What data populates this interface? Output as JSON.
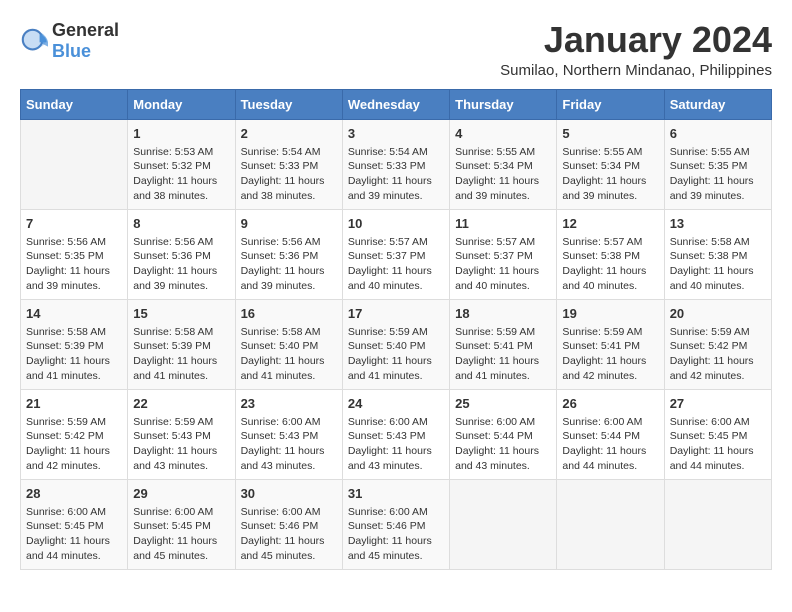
{
  "header": {
    "logo_general": "General",
    "logo_blue": "Blue",
    "title": "January 2024",
    "subtitle": "Sumilao, Northern Mindanao, Philippines"
  },
  "days_of_week": [
    "Sunday",
    "Monday",
    "Tuesday",
    "Wednesday",
    "Thursday",
    "Friday",
    "Saturday"
  ],
  "weeks": [
    [
      {
        "day": "",
        "info": ""
      },
      {
        "day": "1",
        "info": "Sunrise: 5:53 AM\nSunset: 5:32 PM\nDaylight: 11 hours\nand 38 minutes."
      },
      {
        "day": "2",
        "info": "Sunrise: 5:54 AM\nSunset: 5:33 PM\nDaylight: 11 hours\nand 38 minutes."
      },
      {
        "day": "3",
        "info": "Sunrise: 5:54 AM\nSunset: 5:33 PM\nDaylight: 11 hours\nand 39 minutes."
      },
      {
        "day": "4",
        "info": "Sunrise: 5:55 AM\nSunset: 5:34 PM\nDaylight: 11 hours\nand 39 minutes."
      },
      {
        "day": "5",
        "info": "Sunrise: 5:55 AM\nSunset: 5:34 PM\nDaylight: 11 hours\nand 39 minutes."
      },
      {
        "day": "6",
        "info": "Sunrise: 5:55 AM\nSunset: 5:35 PM\nDaylight: 11 hours\nand 39 minutes."
      }
    ],
    [
      {
        "day": "7",
        "info": "Sunrise: 5:56 AM\nSunset: 5:35 PM\nDaylight: 11 hours\nand 39 minutes."
      },
      {
        "day": "8",
        "info": "Sunrise: 5:56 AM\nSunset: 5:36 PM\nDaylight: 11 hours\nand 39 minutes."
      },
      {
        "day": "9",
        "info": "Sunrise: 5:56 AM\nSunset: 5:36 PM\nDaylight: 11 hours\nand 39 minutes."
      },
      {
        "day": "10",
        "info": "Sunrise: 5:57 AM\nSunset: 5:37 PM\nDaylight: 11 hours\nand 40 minutes."
      },
      {
        "day": "11",
        "info": "Sunrise: 5:57 AM\nSunset: 5:37 PM\nDaylight: 11 hours\nand 40 minutes."
      },
      {
        "day": "12",
        "info": "Sunrise: 5:57 AM\nSunset: 5:38 PM\nDaylight: 11 hours\nand 40 minutes."
      },
      {
        "day": "13",
        "info": "Sunrise: 5:58 AM\nSunset: 5:38 PM\nDaylight: 11 hours\nand 40 minutes."
      }
    ],
    [
      {
        "day": "14",
        "info": "Sunrise: 5:58 AM\nSunset: 5:39 PM\nDaylight: 11 hours\nand 41 minutes."
      },
      {
        "day": "15",
        "info": "Sunrise: 5:58 AM\nSunset: 5:39 PM\nDaylight: 11 hours\nand 41 minutes."
      },
      {
        "day": "16",
        "info": "Sunrise: 5:58 AM\nSunset: 5:40 PM\nDaylight: 11 hours\nand 41 minutes."
      },
      {
        "day": "17",
        "info": "Sunrise: 5:59 AM\nSunset: 5:40 PM\nDaylight: 11 hours\nand 41 minutes."
      },
      {
        "day": "18",
        "info": "Sunrise: 5:59 AM\nSunset: 5:41 PM\nDaylight: 11 hours\nand 41 minutes."
      },
      {
        "day": "19",
        "info": "Sunrise: 5:59 AM\nSunset: 5:41 PM\nDaylight: 11 hours\nand 42 minutes."
      },
      {
        "day": "20",
        "info": "Sunrise: 5:59 AM\nSunset: 5:42 PM\nDaylight: 11 hours\nand 42 minutes."
      }
    ],
    [
      {
        "day": "21",
        "info": "Sunrise: 5:59 AM\nSunset: 5:42 PM\nDaylight: 11 hours\nand 42 minutes."
      },
      {
        "day": "22",
        "info": "Sunrise: 5:59 AM\nSunset: 5:43 PM\nDaylight: 11 hours\nand 43 minutes."
      },
      {
        "day": "23",
        "info": "Sunrise: 6:00 AM\nSunset: 5:43 PM\nDaylight: 11 hours\nand 43 minutes."
      },
      {
        "day": "24",
        "info": "Sunrise: 6:00 AM\nSunset: 5:43 PM\nDaylight: 11 hours\nand 43 minutes."
      },
      {
        "day": "25",
        "info": "Sunrise: 6:00 AM\nSunset: 5:44 PM\nDaylight: 11 hours\nand 43 minutes."
      },
      {
        "day": "26",
        "info": "Sunrise: 6:00 AM\nSunset: 5:44 PM\nDaylight: 11 hours\nand 44 minutes."
      },
      {
        "day": "27",
        "info": "Sunrise: 6:00 AM\nSunset: 5:45 PM\nDaylight: 11 hours\nand 44 minutes."
      }
    ],
    [
      {
        "day": "28",
        "info": "Sunrise: 6:00 AM\nSunset: 5:45 PM\nDaylight: 11 hours\nand 44 minutes."
      },
      {
        "day": "29",
        "info": "Sunrise: 6:00 AM\nSunset: 5:45 PM\nDaylight: 11 hours\nand 45 minutes."
      },
      {
        "day": "30",
        "info": "Sunrise: 6:00 AM\nSunset: 5:46 PM\nDaylight: 11 hours\nand 45 minutes."
      },
      {
        "day": "31",
        "info": "Sunrise: 6:00 AM\nSunset: 5:46 PM\nDaylight: 11 hours\nand 45 minutes."
      },
      {
        "day": "",
        "info": ""
      },
      {
        "day": "",
        "info": ""
      },
      {
        "day": "",
        "info": ""
      }
    ]
  ]
}
